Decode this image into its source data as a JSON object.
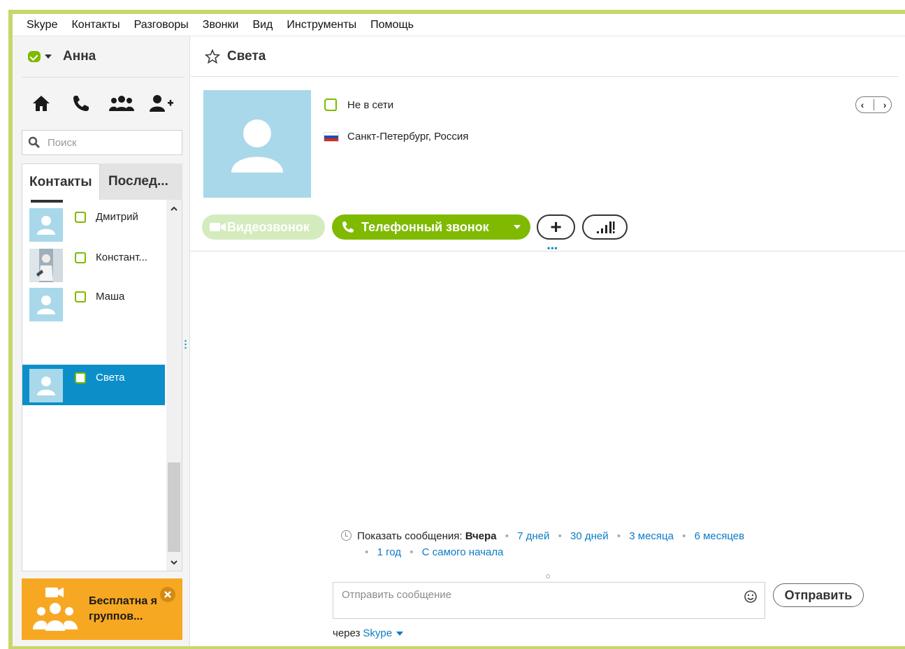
{
  "menu": [
    "Skype",
    "Контакты",
    "Разговоры",
    "Звонки",
    "Вид",
    "Инструменты",
    "Помощь"
  ],
  "user": {
    "name": "Анна",
    "status": "online"
  },
  "search": {
    "placeholder": "Поиск"
  },
  "tabs": {
    "contacts": "Контакты",
    "recent": "Послед..."
  },
  "contacts": [
    {
      "name": "Дмитрий",
      "avatar": "default"
    },
    {
      "name": "Констант...",
      "avatar": "photo"
    },
    {
      "name": "Маша",
      "avatar": "default"
    },
    {
      "name": "Света",
      "avatar": "default",
      "selected": true
    }
  ],
  "promo": {
    "text": "Бесплатна я группов..."
  },
  "conversation": {
    "title": "Света",
    "status": "Не в сети",
    "location": "Санкт-Петербург, Россия",
    "video_label": "Видеозвонок",
    "call_label": "Телефонный звонок",
    "plus_label": "+"
  },
  "history": {
    "label": "Показать сообщения:",
    "current": "Вчера",
    "options": [
      "7 дней",
      "30 дней",
      "3 месяца",
      "6 месяцев",
      "1 год",
      "С самого начала"
    ]
  },
  "compose": {
    "placeholder": "Отправить сообщение",
    "send_label": "Отправить",
    "via_label": "через",
    "via_service": "Skype"
  },
  "colors": {
    "skype_green": "#7fba00",
    "selection_blue": "#0c8fc9",
    "promo_orange": "#f7a823",
    "link_blue": "#0c7bc7",
    "avatar_bg": "#a8d8ea"
  }
}
